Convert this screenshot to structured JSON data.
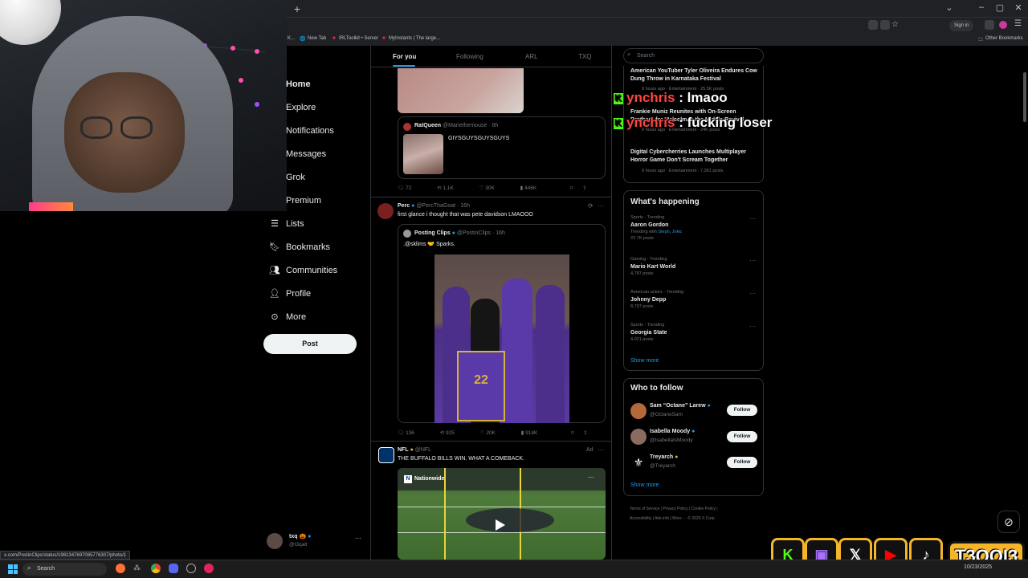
{
  "browser": {
    "bookmarks": [
      "K...",
      "New Tab",
      "IRLToolkit • Server",
      "MyInstants | The large..."
    ],
    "other_bookmarks": "Other Bookmarks",
    "signin": "Sign in"
  },
  "nav": {
    "items": [
      {
        "label": "Home",
        "icon": "home-icon"
      },
      {
        "label": "Explore",
        "icon": "search-icon"
      },
      {
        "label": "Notifications",
        "icon": "bell-icon"
      },
      {
        "label": "Messages",
        "icon": "mail-icon"
      },
      {
        "label": "Grok",
        "icon": "grok-icon"
      },
      {
        "label": "Premium",
        "icon": "x-logo-icon"
      },
      {
        "label": "Lists",
        "icon": "list-icon"
      },
      {
        "label": "Bookmarks",
        "icon": "bookmark-icon"
      },
      {
        "label": "Communities",
        "icon": "people-icon"
      },
      {
        "label": "Profile",
        "icon": "person-icon"
      },
      {
        "label": "More",
        "icon": "more-circle-icon"
      }
    ],
    "post_label": "Post"
  },
  "account": {
    "name": "txq 🎃",
    "handle": "@t3qalt"
  },
  "feed": {
    "tabs": [
      "For you",
      "Following",
      "ARL",
      "TXQ"
    ],
    "tweet1": {
      "quote_name": "RatQueen",
      "quote_handle": "@Mariethemouse · 8h",
      "quote_text": "GIYSGUYSGUYSGUYS",
      "stats": [
        "72",
        "1.1K",
        "30K",
        "446K"
      ]
    },
    "tweet2": {
      "name": "Perc",
      "handle": "@PercThaGoat · 16h",
      "text": "first glance i thought that was pete davidson LMAOOO",
      "quote_name": "Posting Clips",
      "quote_handle": "@PostinClips · 16h",
      "quote_text": ".@sklims 🤝 Sparks.",
      "stats": [
        "136",
        "925",
        "20K",
        "918K"
      ]
    },
    "tweet3": {
      "name": "NFL",
      "handle": "@NFL",
      "ad": "Ad",
      "text": "THE BUFFALO BILLS WIN. WHAT A COMEBACK.",
      "video_label": "Nationwide"
    }
  },
  "right": {
    "search_placeholder": "Search",
    "news": [
      {
        "title": "American YouTuber Tyler Oliveira Endures Cow Dung Throw in Karnataka Festival",
        "meta": "9 hours ago · Entertainment · 25.5K posts"
      },
      {
        "title": "Frankie Muniz Reunites with On-Screen Brothers for Malcolm in the Middle Revival",
        "meta": "9 hours ago · Entertainment · 24K posts"
      },
      {
        "title": "Digital Cybercherries Launches Multiplayer Horror Game Don't Scream Together",
        "meta": "9 hours ago · Entertainment · 7,361 posts"
      }
    ],
    "happening_title": "What's happening",
    "trends": [
      {
        "meta": "Sports · Trending",
        "name": "Aaron Gordon",
        "extra_prefix": "Trending with ",
        "extra_links": "Steph, Jokic",
        "count": "22.7K posts"
      },
      {
        "meta": "Gaming · Trending",
        "name": "Mario Kart World",
        "count": "4,787 posts"
      },
      {
        "meta": "American actors · Trending",
        "name": "Johnny Depp",
        "count": "8,797 posts"
      },
      {
        "meta": "Sports · Trending",
        "name": "Georgia State",
        "count": "4,021 posts"
      }
    ],
    "show_more": "Show more",
    "who_title": "Who to follow",
    "who": [
      {
        "name": "Sam “Octane” Larew",
        "handle": "@OctaneSam",
        "follow": "Follow"
      },
      {
        "name": "Isabella Moody",
        "handle": "@IsabellaIsMoody",
        "follow": "Follow"
      },
      {
        "name": "Treyarch",
        "handle": "@Treyarch",
        "follow": "Follow"
      }
    ],
    "footer": [
      "Terms of Service",
      "|",
      "Privacy Policy",
      "|",
      "Cookie Policy",
      "|",
      "Accessibility",
      "|",
      "Ads info",
      "|",
      "More ···",
      "© 2025 X Corp."
    ]
  },
  "overlay": {
    "chat": [
      {
        "user": "ynchris",
        "msg": " : lmaoo"
      },
      {
        "user": "ynchris",
        "msg": " : fucking loser"
      }
    ],
    "brand": "T3QQI3"
  },
  "status_url": "x.com/PostinClips/status/1981347697085776307/photo/1",
  "taskbar": {
    "search": "Search",
    "date": "10/23/2025"
  },
  "colors": {
    "accent": "#1d9bf0",
    "border": "#2f3336",
    "muted": "#71767b",
    "overlay_gold": "#f5b52a",
    "kick_green": "#53fc18"
  }
}
